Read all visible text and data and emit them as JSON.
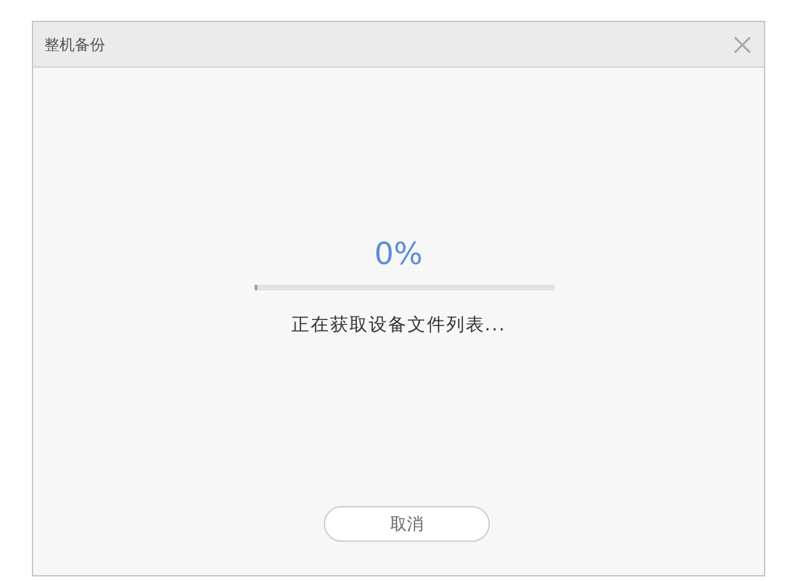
{
  "window": {
    "title": "整机备份"
  },
  "progress": {
    "percent": "0%",
    "level": 0.01,
    "status": "正在获取设备文件列表..."
  },
  "buttons": [
    {
      "label": "取消"
    }
  ]
}
